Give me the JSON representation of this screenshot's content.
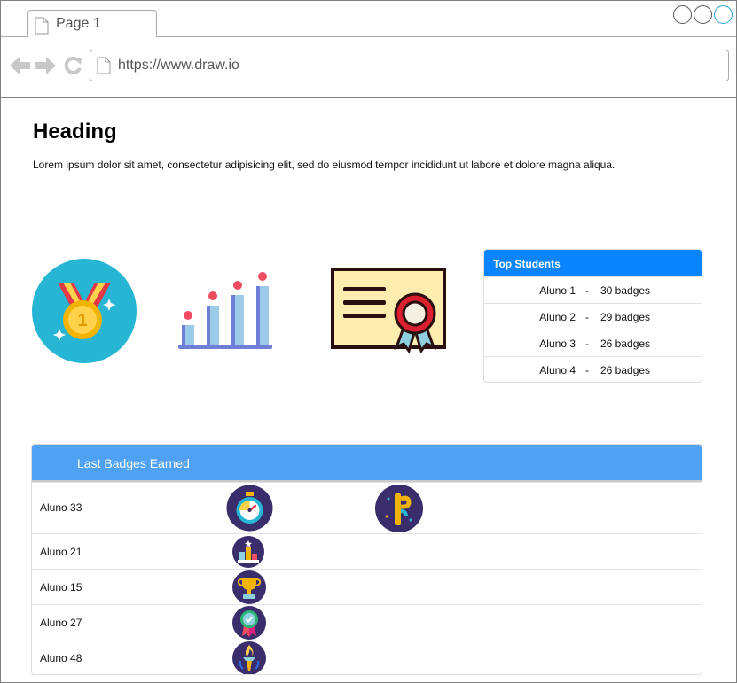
{
  "browser": {
    "tab_label": "Page 1",
    "url": "https://www.draw.io"
  },
  "content": {
    "heading": "Heading",
    "body": "Lorem ipsum dolor sit amet, consectetur adipisicing elit, sed do eiusmod tempor incididunt ut labore et dolore magna aliqua."
  },
  "top_students": {
    "title": "Top Students",
    "rows": [
      {
        "name": "Aluno 1",
        "sep": "-",
        "count": "30 badges"
      },
      {
        "name": "Aluno 2",
        "sep": "-",
        "count": "29 badges"
      },
      {
        "name": "Aluno 3",
        "sep": "-",
        "count": "26 badges"
      },
      {
        "name": "Aluno 4",
        "sep": "-",
        "count": "26 badges"
      }
    ]
  },
  "last_badges": {
    "title": "Last Badges Earned",
    "rows": [
      {
        "student": "Aluno 33",
        "badges": [
          "stopwatch-badge-icon",
          "flag-badge-icon"
        ]
      },
      {
        "student": "Aluno 21",
        "badges": [
          "podium-badge-icon"
        ]
      },
      {
        "student": "Aluno 15",
        "badges": [
          "trophy-badge-icon"
        ]
      },
      {
        "student": "Aluno 27",
        "badges": [
          "ribbon-badge-icon"
        ]
      },
      {
        "student": "Aluno 48",
        "badges": [
          "torch-badge-icon"
        ]
      }
    ]
  },
  "colors": {
    "accent": "#0a85ff",
    "table_header": "#4ea1f3",
    "badge_bg": "#3a2d6b"
  }
}
